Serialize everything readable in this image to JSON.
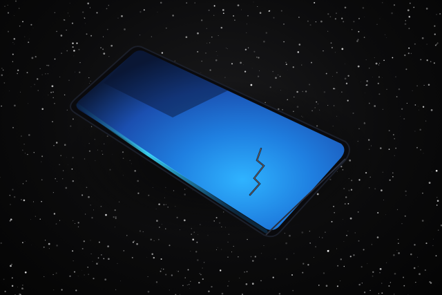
{
  "scene": {
    "subject": "smartphone",
    "surface": "black glitter",
    "colors": {
      "background": "#050505",
      "screen_top": "#0b1a3a",
      "screen_mid": "#1f63c9",
      "screen_glow": "#2fb3ff",
      "edge_cyan": "#3fe0ff",
      "frame": "#0a0a0d"
    }
  }
}
